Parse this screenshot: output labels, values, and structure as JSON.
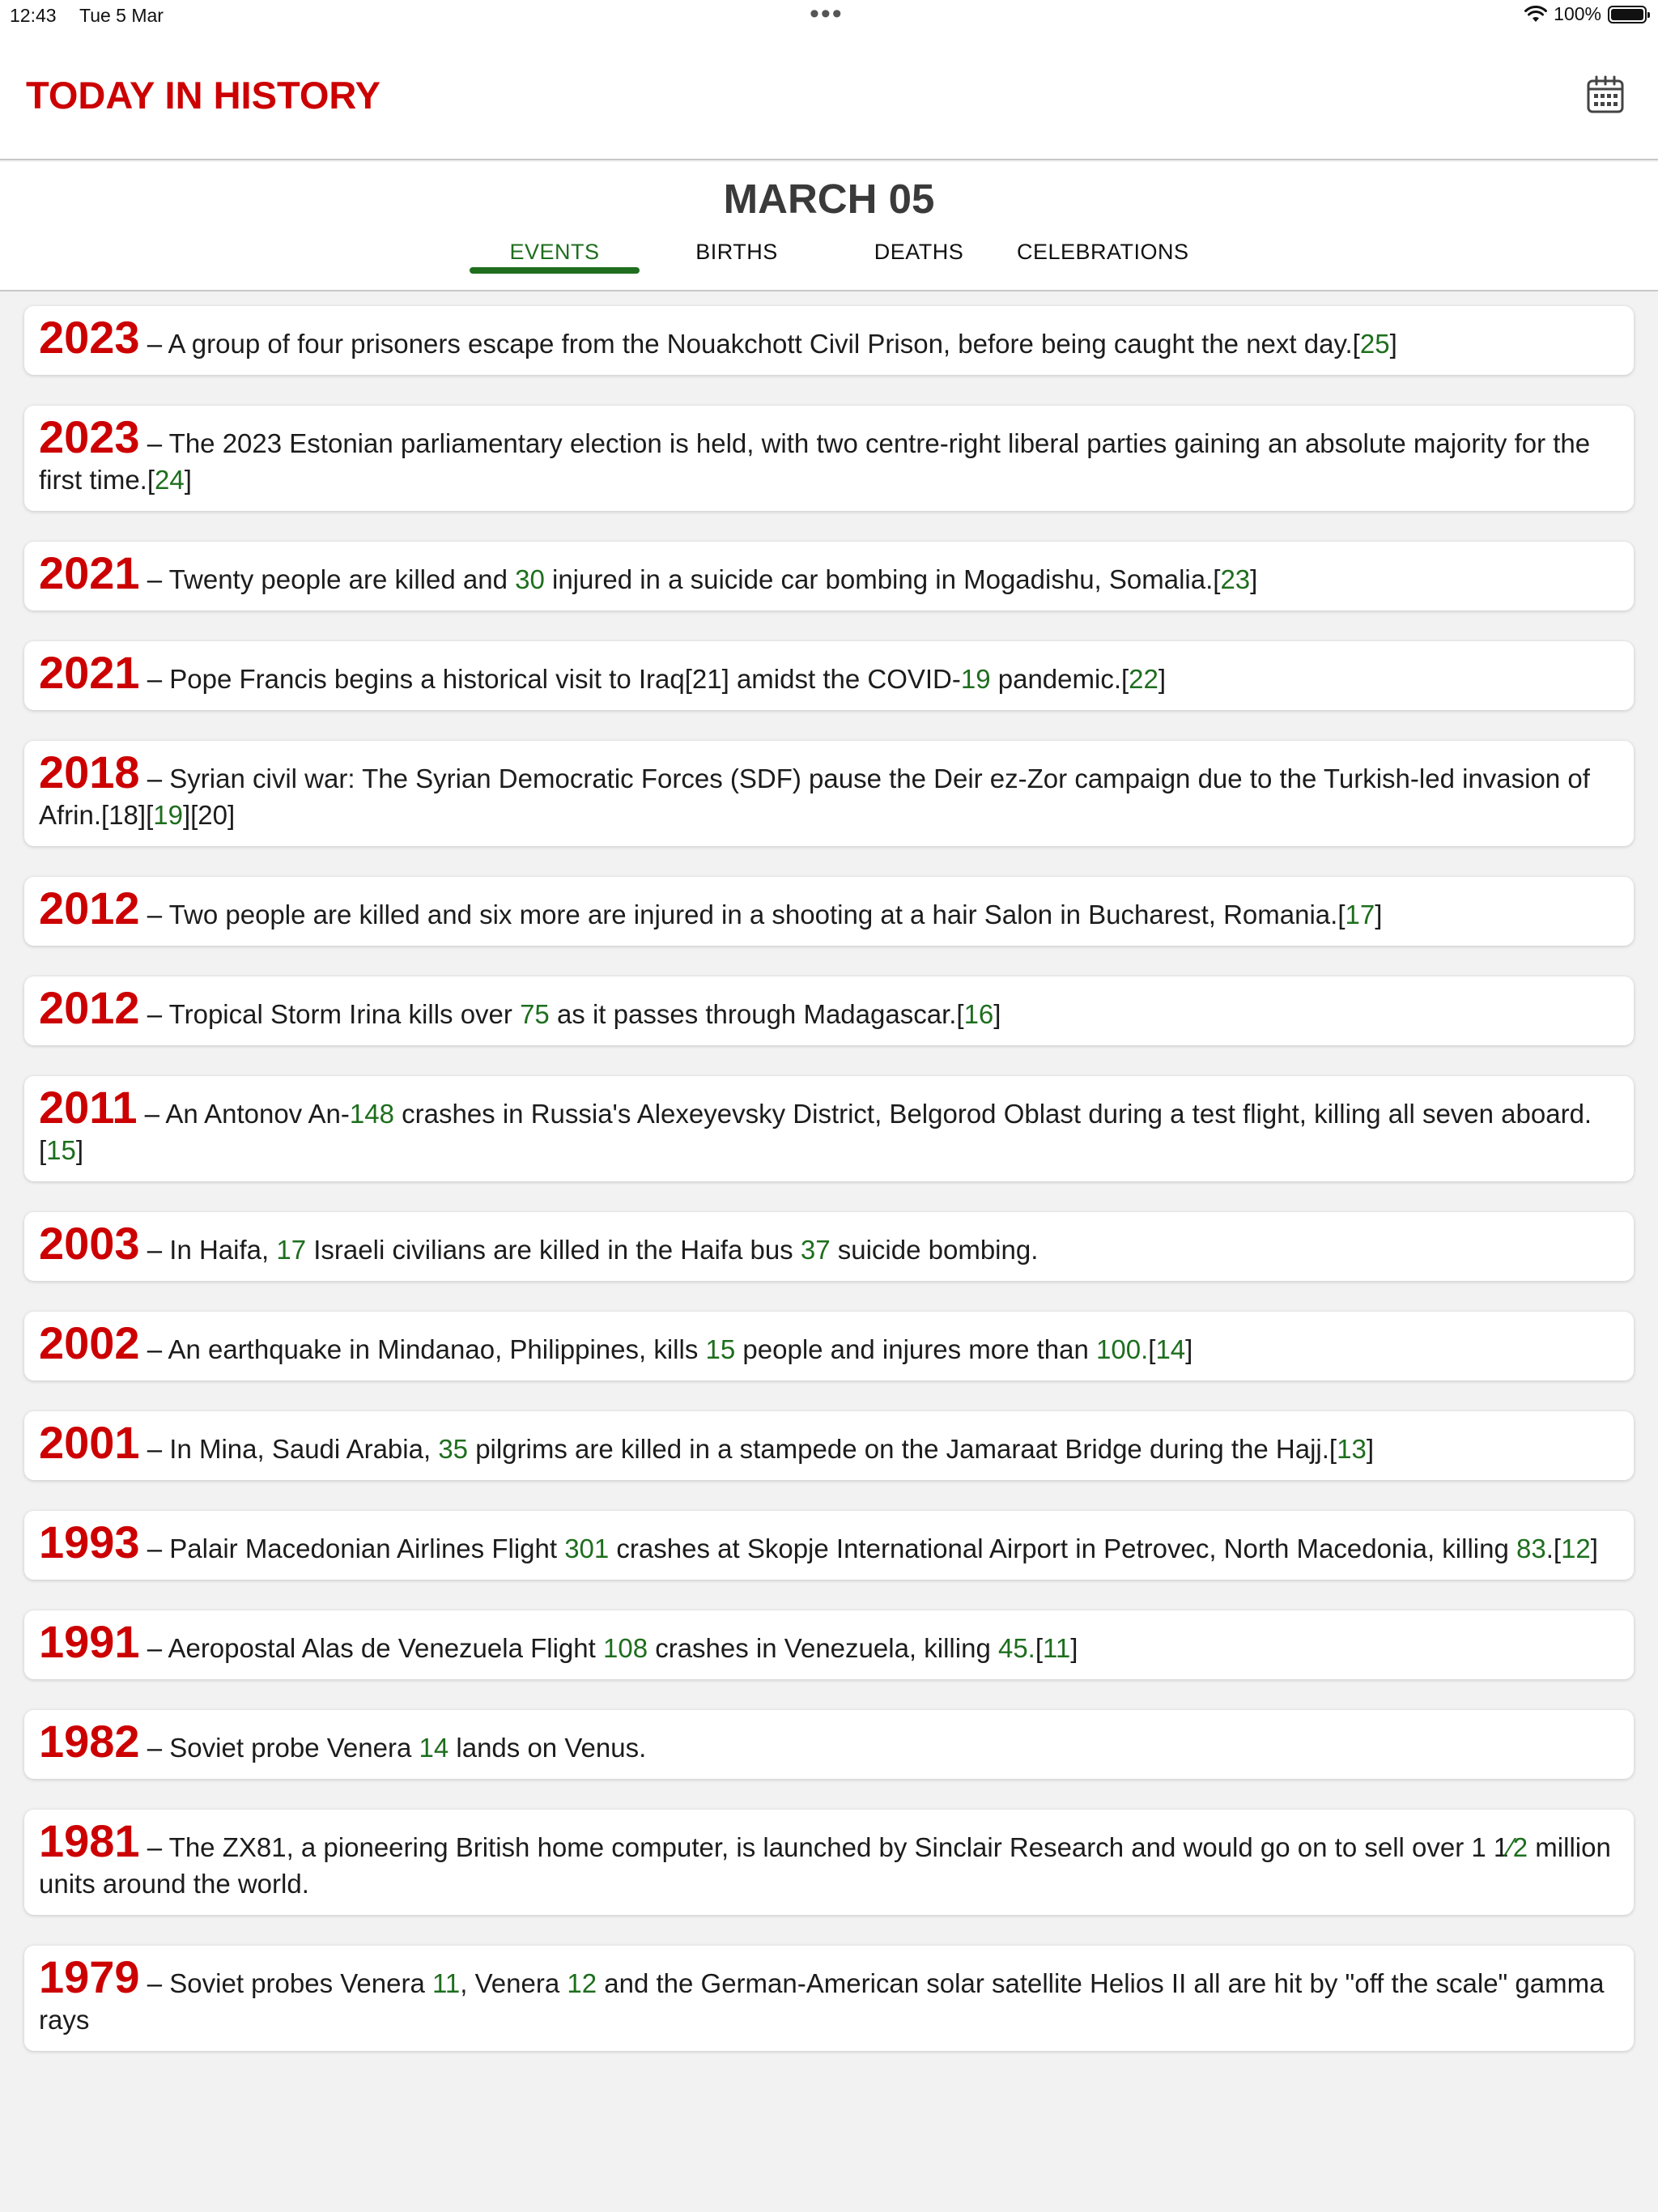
{
  "status_bar": {
    "time": "12:43",
    "date": "Tue 5 Mar",
    "battery": "100%",
    "battery_level": 1.0
  },
  "header": {
    "title": "TODAY IN HISTORY",
    "calendar_icon": "calendar-icon"
  },
  "date_title": "MARCH 05",
  "tabs": [
    {
      "label": "EVENTS",
      "active": true
    },
    {
      "label": "BIRTHS",
      "active": false
    },
    {
      "label": "DEATHS",
      "active": false
    },
    {
      "label": "CELEBRATIONS",
      "active": false
    }
  ],
  "colors": {
    "accent_red": "#cc0000",
    "accent_green": "#1e6e1e",
    "background": "#f2f2f2"
  },
  "events": [
    {
      "year": "2023",
      "parts": [
        {
          "t": "A group of four prisoners escape from the Nouakchott Civil Prison, before being caught the next day.[",
          "n": false
        },
        {
          "t": "25",
          "n": true
        },
        {
          "t": "]",
          "n": false
        }
      ]
    },
    {
      "year": "2023",
      "parts": [
        {
          "t": "The 2023 Estonian parliamentary election is held, with two centre-right liberal parties gaining an absolute majority for the first time.[",
          "n": false
        },
        {
          "t": "24",
          "n": true
        },
        {
          "t": "]",
          "n": false
        }
      ]
    },
    {
      "year": "2021",
      "parts": [
        {
          "t": "Twenty people are killed and ",
          "n": false
        },
        {
          "t": "30",
          "n": true
        },
        {
          "t": " injured in a suicide car bombing in Mogadishu, Somalia.[",
          "n": false
        },
        {
          "t": "23",
          "n": true
        },
        {
          "t": "]",
          "n": false
        }
      ]
    },
    {
      "year": "2021",
      "parts": [
        {
          "t": "Pope Francis begins a historical visit to Iraq[21] amidst the COVID-",
          "n": false
        },
        {
          "t": "19",
          "n": true
        },
        {
          "t": " pandemic.[",
          "n": false
        },
        {
          "t": "22",
          "n": true
        },
        {
          "t": "]",
          "n": false
        }
      ]
    },
    {
      "year": "2018",
      "parts": [
        {
          "t": "Syrian civil war: The Syrian Democratic Forces (SDF) pause the Deir ez-Zor campaign due to the Turkish-led invasion of Afrin.[18][",
          "n": false
        },
        {
          "t": "19",
          "n": true
        },
        {
          "t": "][20]",
          "n": false
        }
      ]
    },
    {
      "year": "2012",
      "parts": [
        {
          "t": "Two people are killed and six more are injured in a shooting at a hair Salon in Bucharest, Romania.[",
          "n": false
        },
        {
          "t": "17",
          "n": true
        },
        {
          "t": "]",
          "n": false
        }
      ]
    },
    {
      "year": "2012",
      "parts": [
        {
          "t": "Tropical Storm Irina kills over ",
          "n": false
        },
        {
          "t": "75",
          "n": true
        },
        {
          "t": " as it passes through Madagascar.[",
          "n": false
        },
        {
          "t": "16",
          "n": true
        },
        {
          "t": "]",
          "n": false
        }
      ]
    },
    {
      "year": "2011",
      "parts": [
        {
          "t": "An Antonov An-",
          "n": false
        },
        {
          "t": "148",
          "n": true
        },
        {
          "t": " crashes in Russia's Alexeyevsky District, Belgorod Oblast during a test flight, killing all seven aboard.[",
          "n": false
        },
        {
          "t": "15",
          "n": true
        },
        {
          "t": "]",
          "n": false
        }
      ]
    },
    {
      "year": "2003",
      "parts": [
        {
          "t": "In Haifa, ",
          "n": false
        },
        {
          "t": "17",
          "n": true
        },
        {
          "t": " Israeli civilians are killed in the Haifa bus ",
          "n": false
        },
        {
          "t": "37",
          "n": true
        },
        {
          "t": " suicide bombing.",
          "n": false
        }
      ]
    },
    {
      "year": "2002",
      "parts": [
        {
          "t": "An earthquake in Mindanao, Philippines, kills ",
          "n": false
        },
        {
          "t": "15",
          "n": true
        },
        {
          "t": " people and injures more than ",
          "n": false
        },
        {
          "t": "100.",
          "n": true
        },
        {
          "t": "[",
          "n": false
        },
        {
          "t": "14",
          "n": true
        },
        {
          "t": "]",
          "n": false
        }
      ]
    },
    {
      "year": "2001",
      "parts": [
        {
          "t": "In Mina, Saudi Arabia, ",
          "n": false
        },
        {
          "t": "35",
          "n": true
        },
        {
          "t": " pilgrims are killed in a stampede on the Jamaraat Bridge during the Hajj.[",
          "n": false
        },
        {
          "t": "13",
          "n": true
        },
        {
          "t": "]",
          "n": false
        }
      ]
    },
    {
      "year": "1993",
      "parts": [
        {
          "t": "Palair Macedonian Airlines Flight ",
          "n": false
        },
        {
          "t": "301",
          "n": true
        },
        {
          "t": " crashes at Skopje International Airport in Petrovec, North Macedonia, killing ",
          "n": false
        },
        {
          "t": "83",
          "n": true
        },
        {
          "t": ".[",
          "n": false
        },
        {
          "t": "12",
          "n": true
        },
        {
          "t": "]",
          "n": false
        }
      ]
    },
    {
      "year": "1991",
      "parts": [
        {
          "t": "Aeropostal Alas de Venezuela Flight ",
          "n": false
        },
        {
          "t": "108",
          "n": true
        },
        {
          "t": " crashes in Venezuela, killing ",
          "n": false
        },
        {
          "t": "45.",
          "n": true
        },
        {
          "t": "[",
          "n": false
        },
        {
          "t": "11",
          "n": true
        },
        {
          "t": "]",
          "n": false
        }
      ]
    },
    {
      "year": "1982",
      "parts": [
        {
          "t": "Soviet probe Venera ",
          "n": false
        },
        {
          "t": "14",
          "n": true
        },
        {
          "t": " lands on Venus.",
          "n": false
        }
      ]
    },
    {
      "year": "1981",
      "parts": [
        {
          "t": "The ZX81, a pioneering British home computer, is launched by Sinclair Research and would go on to sell over 1 1",
          "n": false
        },
        {
          "t": "⁄2",
          "n": true
        },
        {
          "t": " million units around the world.",
          "n": false
        }
      ]
    },
    {
      "year": "1979",
      "parts": [
        {
          "t": "Soviet probes Venera ",
          "n": false
        },
        {
          "t": "11",
          "n": true
        },
        {
          "t": ", Venera ",
          "n": false
        },
        {
          "t": "12",
          "n": true
        },
        {
          "t": " and the German-American solar satellite Helios II all are hit by \"off the scale\" gamma rays",
          "n": false
        }
      ]
    }
  ]
}
